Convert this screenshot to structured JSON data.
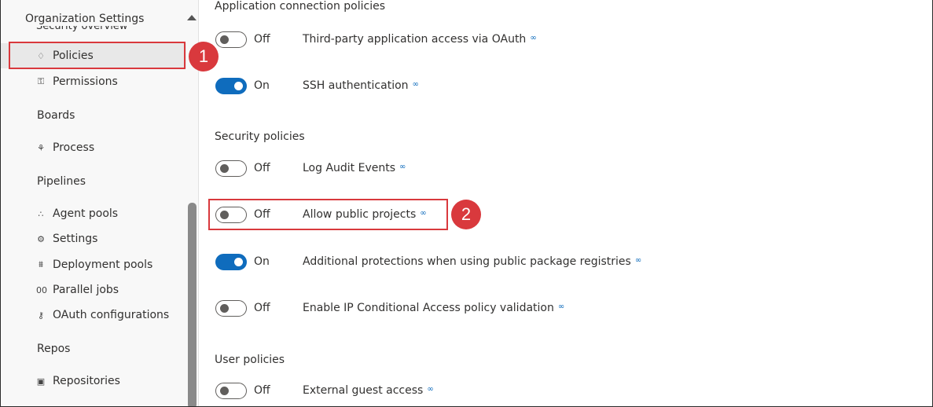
{
  "sidebar": {
    "title": "Organization Settings",
    "cut_item": "Security overview",
    "items": [
      {
        "label": "Policies",
        "icon": "lightbulb-icon",
        "glyph": "♢"
      },
      {
        "label": "Permissions",
        "icon": "lock-icon",
        "glyph": "⚿"
      }
    ],
    "sections": [
      {
        "title": "Boards"
      },
      {
        "title": "Pipelines"
      },
      {
        "title": "Repos"
      }
    ],
    "boards_items": [
      {
        "label": "Process",
        "glyph": "⚘"
      }
    ],
    "pipelines_items": [
      {
        "label": "Agent pools",
        "glyph": "∴"
      },
      {
        "label": "Settings",
        "glyph": "⚙"
      },
      {
        "label": "Deployment pools",
        "glyph": "⩩"
      },
      {
        "label": "Parallel jobs",
        "glyph": "00"
      },
      {
        "label": "OAuth configurations",
        "glyph": "⚷"
      }
    ],
    "repos_items": [
      {
        "label": "Repositories",
        "glyph": "▣"
      }
    ]
  },
  "callouts": {
    "one": "1",
    "two": "2"
  },
  "main": {
    "header": "Application connection policies",
    "app_policies": [
      {
        "state": "Off",
        "label": "Third-party application access via OAuth",
        "on": false
      },
      {
        "state": "On",
        "label": "SSH authentication",
        "on": true
      }
    ],
    "security_title": "Security policies",
    "security_policies": [
      {
        "state": "Off",
        "label": "Log Audit Events",
        "on": false
      },
      {
        "state": "Off",
        "label": "Allow public projects",
        "on": false
      },
      {
        "state": "On",
        "label": "Additional protections when using public package registries",
        "on": true
      },
      {
        "state": "Off",
        "label": "Enable IP Conditional Access policy validation",
        "on": false
      }
    ],
    "user_title": "User policies",
    "user_policies": [
      {
        "state": "Off",
        "label": "External guest access",
        "on": false
      }
    ]
  },
  "colors": {
    "accent": "#0f6cbd",
    "callout": "#d9393d"
  }
}
